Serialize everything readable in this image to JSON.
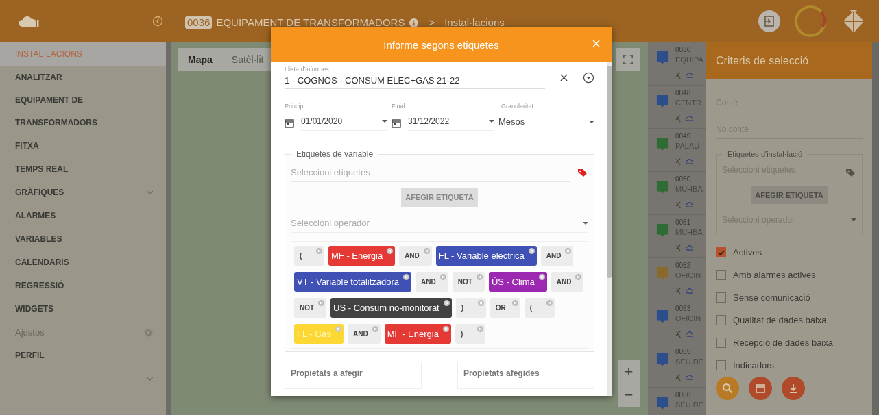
{
  "top_bar": {
    "code": "0036",
    "title": "EQUIPAMENT DE TRANSFORMADORS",
    "separator": ">",
    "breadcrumb": "Instal·lacions"
  },
  "sidebar": {
    "items": [
      {
        "label": "INSTAL·LACIONS",
        "selected": true,
        "kind": "item"
      },
      {
        "label": "ANALITZAR",
        "selected": false,
        "kind": "item"
      },
      {
        "label": "EQUIPAMENT DE TRANSFORMADORS",
        "selected": false,
        "kind": "item"
      },
      {
        "label": "FITXA",
        "selected": false,
        "kind": "item"
      },
      {
        "label": "TEMPS REAL",
        "selected": false,
        "kind": "item"
      },
      {
        "label": "GRÀFIQUES",
        "selected": false,
        "kind": "expandable"
      },
      {
        "label": "ALARMES",
        "selected": false,
        "kind": "item"
      },
      {
        "label": "VARIABLES",
        "selected": false,
        "kind": "item"
      },
      {
        "label": "CALENDARIS",
        "selected": false,
        "kind": "item"
      },
      {
        "label": "REGRESSIÓ",
        "selected": false,
        "kind": "item"
      },
      {
        "label": "WIDGETS",
        "selected": false,
        "kind": "item"
      },
      {
        "label": "Ajustos",
        "selected": false,
        "kind": "settings"
      },
      {
        "label": "PERFIL",
        "selected": false,
        "kind": "item"
      }
    ]
  },
  "map": {
    "tabs": [
      {
        "label": "Mapa",
        "selected": true
      },
      {
        "label": "Satèl·lit",
        "selected": false
      }
    ],
    "zoom_in": "+",
    "zoom_out": "−"
  },
  "installations": [
    {
      "code": "0036",
      "name": "EQUIPA",
      "color": "#2c4f8c"
    },
    {
      "code": "0048",
      "name": "CENTR",
      "color": "#2c4f8c"
    },
    {
      "code": "0049",
      "name": "PALAU",
      "color": "#2f6b35"
    },
    {
      "code": "0050",
      "name": "MUHBA",
      "color": "#2f6b35"
    },
    {
      "code": "0051",
      "name": "MUHBA",
      "color": "#2f6b35"
    },
    {
      "code": "0052",
      "name": "OFICIN",
      "color": "#8a6a2a"
    },
    {
      "code": "0053",
      "name": "OFICIN",
      "color": "#2c4f8c"
    },
    {
      "code": "0055",
      "name": "SEU DE",
      "color": "#2c4f8c"
    },
    {
      "code": "0056",
      "name": "SEU DE",
      "color": "#2c4f8c"
    }
  ],
  "criteria": {
    "title": "Criteris de selecció",
    "contains": {
      "placeholder": "Conté"
    },
    "not_contains": {
      "placeholder": "No conté"
    },
    "tags": {
      "legend": "Etiquetes d'instal·lació",
      "placeholder": "Seleccioni etiquetes",
      "button": "AFEGIR ETIQUETA",
      "operator": {
        "placeholder": "Seleccioni operador"
      }
    },
    "filters": [
      {
        "label": "Actives",
        "checked": true
      },
      {
        "label": "Amb alarmes actives",
        "checked": false
      },
      {
        "label": "Sense comunicació",
        "checked": false
      },
      {
        "label": "Qualitat de dades baixa",
        "checked": false
      },
      {
        "label": "Recepció de dades baixa",
        "checked": false
      },
      {
        "label": "Indicadors",
        "checked": false
      }
    ]
  },
  "dialog": {
    "title": "Informe segons etiquetes",
    "close": "×",
    "report": {
      "label": "Llista d'informes",
      "value": "1 - COGNOS - CONSUM ELEC+GAS 21-22"
    },
    "start": {
      "label": "Principi",
      "value": "01/01/2020"
    },
    "end": {
      "label": "Final",
      "value": "31/12/2022"
    },
    "granularity": {
      "label": "Granularitat",
      "value": "Mesos"
    },
    "variable_tags": {
      "legend": "Etiquetes de variable",
      "placeholder": "Seleccioni etiquetes",
      "button": "AFEGIR ETIQUETA",
      "operator": {
        "placeholder": "Seleccioni operador"
      }
    },
    "expression": [
      {
        "kind": "operator",
        "label": "("
      },
      {
        "kind": "tag",
        "label": "MF - Energia",
        "color": "#e53935"
      },
      {
        "kind": "operator",
        "label": "AND"
      },
      {
        "kind": "tag",
        "label": "FL - Variable elèctrica",
        "color": "#3f51b5"
      },
      {
        "kind": "operator",
        "label": "AND"
      },
      {
        "kind": "tag",
        "label": "VT - Variable totalitzadora",
        "color": "#3f51b5"
      },
      {
        "kind": "operator",
        "label": "AND"
      },
      {
        "kind": "operator",
        "label": "NOT"
      },
      {
        "kind": "tag",
        "label": "ÙS - Clima",
        "color": "#9c27b0"
      },
      {
        "kind": "operator",
        "label": "AND"
      },
      {
        "kind": "operator",
        "label": "NOT"
      },
      {
        "kind": "tag",
        "label": "US - Consum no-monitorat",
        "color": "#424242"
      },
      {
        "kind": "operator",
        "label": ")"
      },
      {
        "kind": "operator",
        "label": "OR"
      },
      {
        "kind": "operator",
        "label": "("
      },
      {
        "kind": "tag",
        "label": "FL - Gas",
        "color": "#fdd835"
      },
      {
        "kind": "operator",
        "label": "AND"
      },
      {
        "kind": "tag",
        "label": "MF - Energia",
        "color": "#e53935"
      },
      {
        "kind": "operator",
        "label": ")"
      }
    ],
    "properties": [
      {
        "title": "Propietats a afegir"
      },
      {
        "title": "Propietats afegides"
      }
    ]
  }
}
